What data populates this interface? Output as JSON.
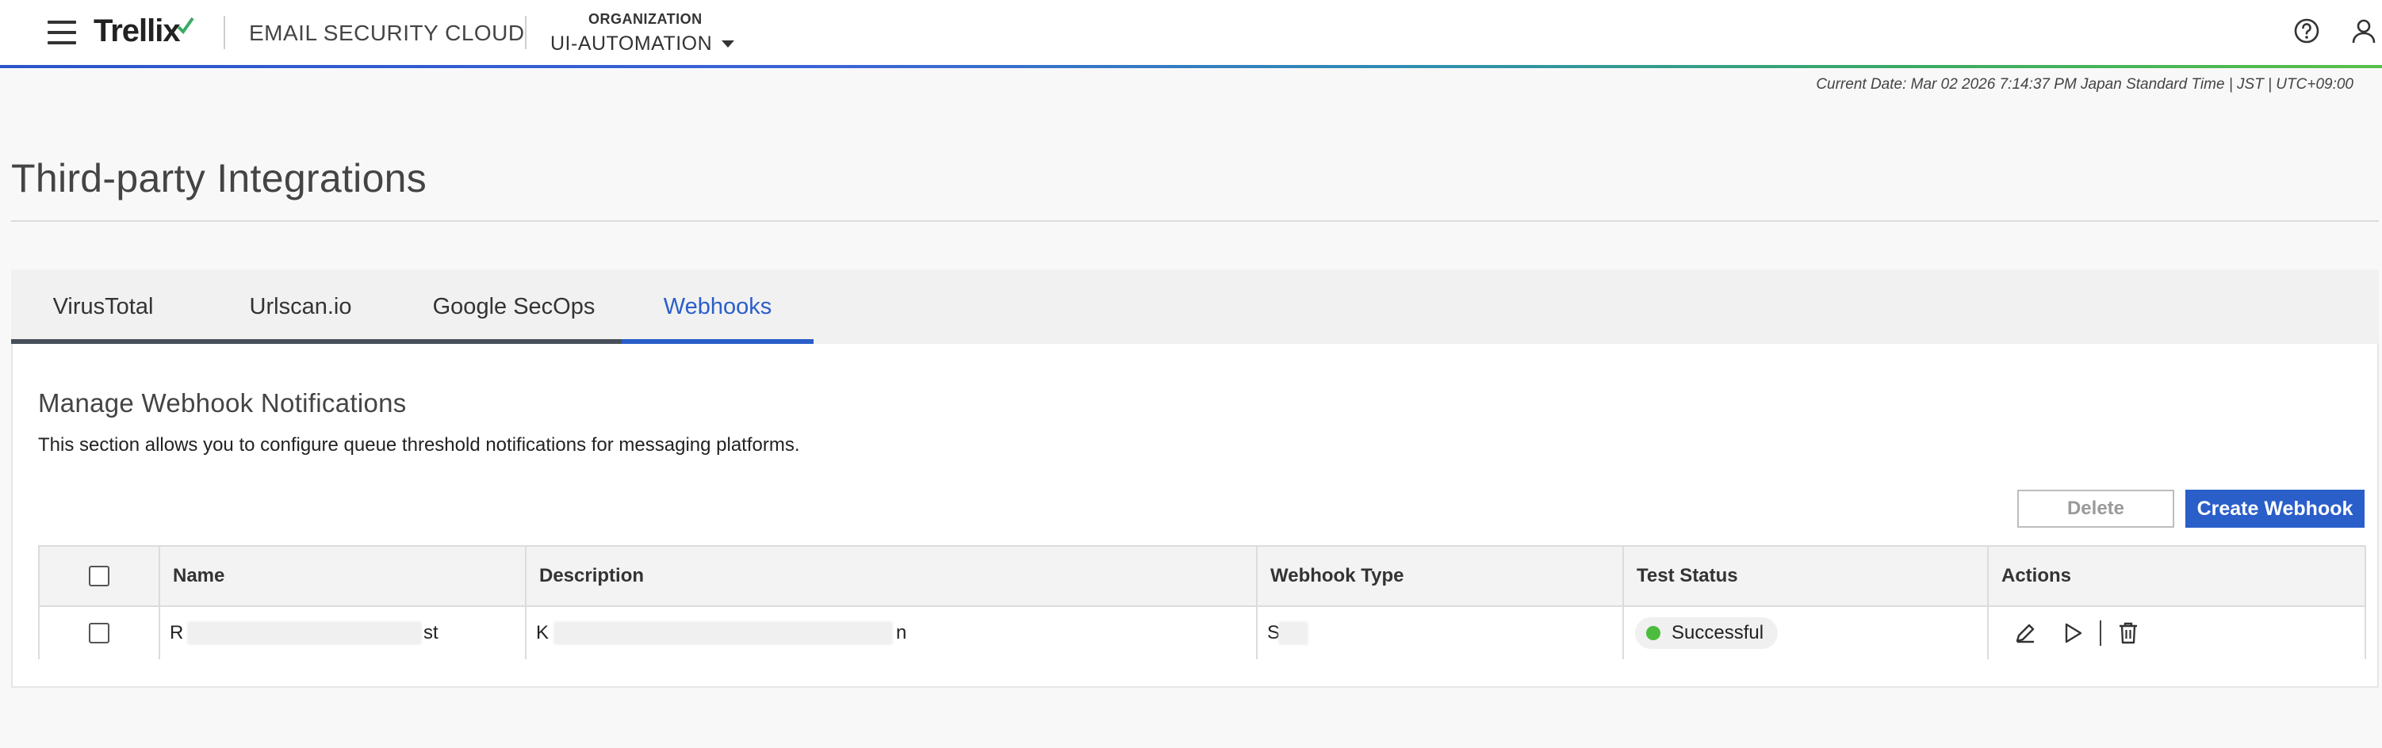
{
  "header": {
    "logo_text": "Trellix",
    "product_name": "EMAIL SECURITY CLOUD",
    "org_label": "ORGANIZATION",
    "org_value": "UI-AUTOMATION",
    "icons": [
      "menu-icon",
      "help-icon",
      "user-icon"
    ]
  },
  "current_date": "Current Date: Mar 02 2026 7:14:37 PM Japan Standard Time | JST | UTC+09:00",
  "page_title": "Third-party Integrations",
  "tabs": [
    {
      "label": "VirusTotal",
      "active": false
    },
    {
      "label": "Urlscan.io",
      "active": false
    },
    {
      "label": "Google SecOps",
      "active": false
    },
    {
      "label": "Webhooks",
      "active": true
    }
  ],
  "section": {
    "title": "Manage Webhook Notifications",
    "description": "This section allows you to configure queue threshold notifications for messaging platforms."
  },
  "buttons": {
    "delete": "Delete",
    "create": "Create Webhook"
  },
  "table": {
    "columns": [
      "Name",
      "Description",
      "Webhook Type",
      "Test Status",
      "Actions"
    ],
    "rows": [
      {
        "name": "R",
        "name_tail": "st",
        "description": "K",
        "description_tail": "n",
        "webhook_type": "S",
        "test_status": "Successful",
        "actions": [
          "edit-icon",
          "play-icon",
          "trash-icon"
        ]
      }
    ]
  },
  "colors": {
    "accent": "#2a5ec9",
    "success": "#4cbc3f"
  }
}
